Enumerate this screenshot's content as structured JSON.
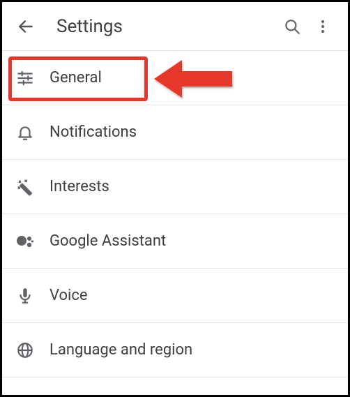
{
  "header": {
    "title": "Settings"
  },
  "items": [
    {
      "label": "General"
    },
    {
      "label": "Notifications"
    },
    {
      "label": "Interests"
    },
    {
      "label": "Google Assistant"
    },
    {
      "label": "Voice"
    },
    {
      "label": "Language and region"
    }
  ]
}
